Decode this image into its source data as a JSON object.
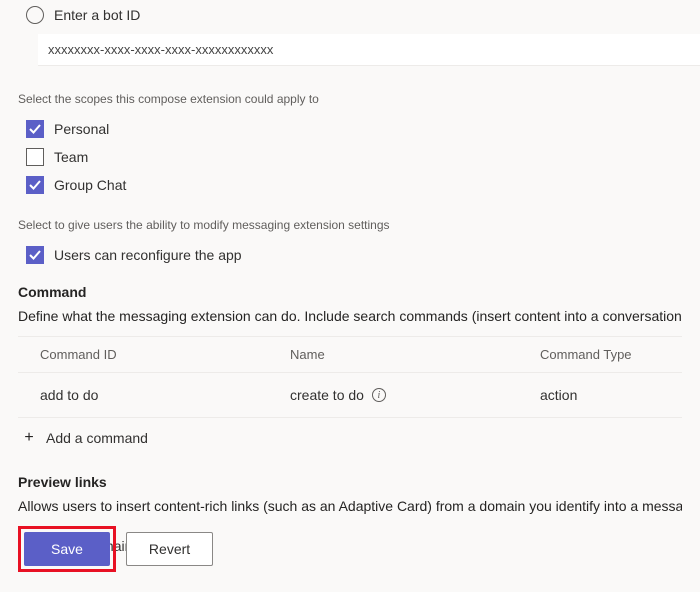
{
  "bot": {
    "radio_label": "Enter a bot ID",
    "id_value": "xxxxxxxx-xxxx-xxxx-xxxx-xxxxxxxxxxxx"
  },
  "scopes": {
    "caption": "Select the scopes this compose extension could apply to",
    "items": [
      {
        "label": "Personal",
        "checked": true
      },
      {
        "label": "Team",
        "checked": false
      },
      {
        "label": "Group Chat",
        "checked": true
      }
    ]
  },
  "reconfigure": {
    "caption": "Select to give users the ability to modify messaging extension settings",
    "label": "Users can reconfigure the app",
    "checked": true
  },
  "command_section": {
    "title": "Command",
    "desc": "Define what the messaging extension can do. Include search commands (insert content into a conversation), action commands (a",
    "headers": {
      "id": "Command ID",
      "name": "Name",
      "type": "Command Type"
    },
    "rows": [
      {
        "id": "add to do",
        "name": "create to do",
        "type": "action"
      }
    ],
    "add_label": "Add a command"
  },
  "preview_section": {
    "title": "Preview links",
    "desc": "Allows users to insert content-rich links (such as an Adaptive Card) from a domain you identify into a message. (This capability is ",
    "add_label": "Add a domain"
  },
  "footer": {
    "save": "Save",
    "revert": "Revert"
  }
}
